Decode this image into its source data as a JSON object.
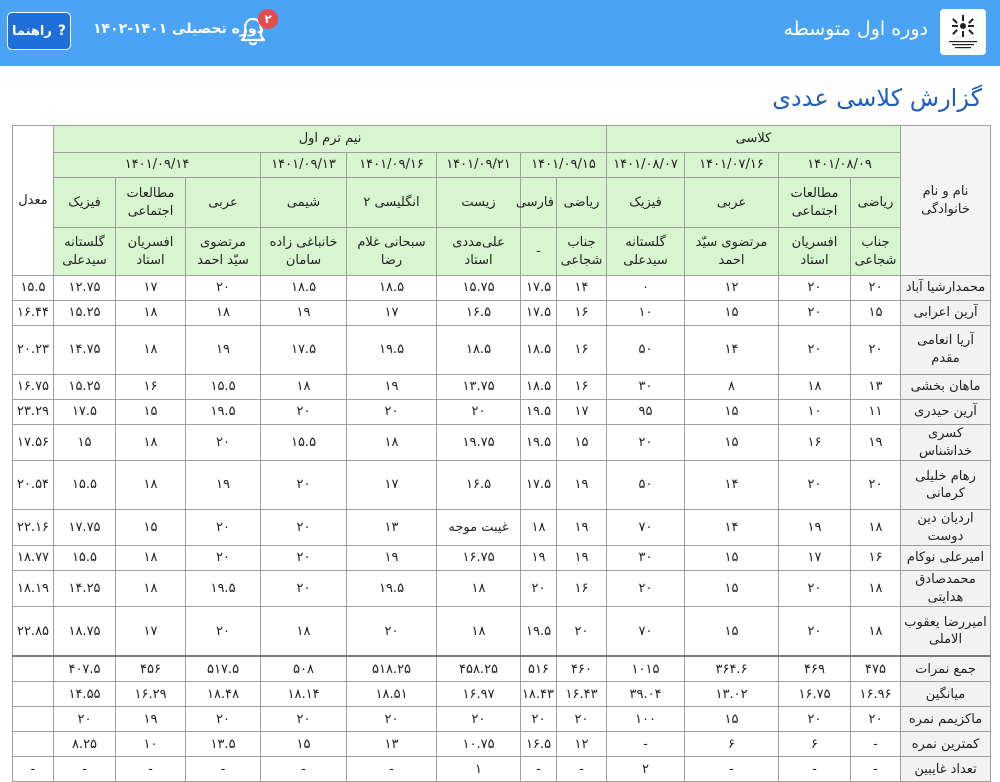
{
  "header": {
    "org_title": "دوره اول متوسطه",
    "term_label": "دوره تحصیلی ۱۴۰۱-۱۴۰۲",
    "notification_count": "۲",
    "help_label": "راهنما",
    "help_icon": "?",
    "colors": {
      "bar": "#4aa3f5",
      "button": "#1e6fd9",
      "badge": "#e54b4b"
    }
  },
  "page_title": "گزارش کلاسی عددی",
  "table": {
    "name_header": "نام و نام خانوادگی",
    "avg_header": "معدل",
    "group_class": "کلاسی",
    "group_midterm": "نیم ترم اول",
    "dates": [
      "۱۴۰۱/۰۸/۰۹",
      "۱۴۰۱/۰۷/۱۶",
      "۱۴۰۱/۰۸/۰۷",
      "۱۴۰۱/۰۹/۱۵",
      "۱۴۰۱/۰۹/۲۱",
      "۱۴۰۱/۰۹/۱۶",
      "۱۴۰۱/۰۹/۱۳",
      "۱۴۰۱/۰۹/۱۴"
    ],
    "subjects": [
      "ریاضی",
      "مطالعات اجتماعی",
      "عربی",
      "فیزیک",
      "ریاضی",
      "فارسی",
      "زیست",
      "انگلیسی ۲",
      "شیمی",
      "عربی",
      "مطالعات اجتماعی",
      "فیزیک"
    ],
    "teachers": [
      "جناب شجاعی",
      "افسریان استاد",
      "مرتضوی سیّد احمد",
      "گلستانه سیدعلی",
      "جناب شجاعی",
      "-",
      "علی‌مددی استاد",
      "سبحانی غلام رضا",
      "خانباغی زاده سامان",
      "مرتضوی سیّد احمد",
      "افسریان استاد",
      "گلستانه سیدعلی"
    ],
    "rows": [
      {
        "name": "محمدارشیا آباد",
        "scores": [
          "۲۰",
          "۲۰",
          "۱۲",
          "۰",
          "۱۴",
          "۱۷.۵",
          "۱۵.۷۵",
          "۱۸.۵",
          "۱۸.۵",
          "۲۰",
          "۱۷",
          "۱۲.۷۵"
        ],
        "avg": "۱۵.۵"
      },
      {
        "name": "آرین اعرابی",
        "scores": [
          "۱۵",
          "۲۰",
          "۱۵",
          "۱۰",
          "۱۶",
          "۱۷.۵",
          "۱۶.۵",
          "۱۷",
          "۱۹",
          "۱۸",
          "۱۸",
          "۱۵.۲۵"
        ],
        "avg": "۱۶.۴۴"
      },
      {
        "name": "آریا انعامی مقدم",
        "scores": [
          "۲۰",
          "۲۰",
          "۱۴",
          "۵۰",
          "۱۶",
          "۱۸.۵",
          "۱۸.۵",
          "۱۹.۵",
          "۱۷.۵",
          "۱۹",
          "۱۸",
          "۱۴.۷۵"
        ],
        "avg": "۲۰.۲۳"
      },
      {
        "name": "ماهان بخشی",
        "scores": [
          "۱۳",
          "۱۸",
          "۸",
          "۳۰",
          "۱۶",
          "۱۸.۵",
          "۱۳.۷۵",
          "۱۹",
          "۱۸",
          "۱۵.۵",
          "۱۶",
          "۱۵.۲۵"
        ],
        "avg": "۱۶.۷۵"
      },
      {
        "name": "آرین حیدری",
        "scores": [
          "۱۱",
          "۱۰",
          "۱۵",
          "۹۵",
          "۱۷",
          "۱۹.۵",
          "۲۰",
          "۲۰",
          "۲۰",
          "۱۹.۵",
          "۱۵",
          "۱۷.۵"
        ],
        "avg": "۲۳.۲۹"
      },
      {
        "name": "کسری خداشناس",
        "scores": [
          "۱۹",
          "۱۶",
          "۱۵",
          "۲۰",
          "۱۵",
          "۱۹.۵",
          "۱۹.۷۵",
          "۱۸",
          "۱۵.۵",
          "۲۰",
          "۱۸",
          "۱۵"
        ],
        "avg": "۱۷.۵۶"
      },
      {
        "name": "رهام خلیلی کرمانی",
        "scores": [
          "۲۰",
          "۲۰",
          "۱۴",
          "۵۰",
          "۱۹",
          "۱۷.۵",
          "۱۶.۵",
          "۱۷",
          "۲۰",
          "۱۹",
          "۱۸",
          "۱۵.۵"
        ],
        "avg": "۲۰.۵۴"
      },
      {
        "name": "اردیان دین دوست",
        "scores": [
          "۱۸",
          "۱۹",
          "۱۴",
          "۷۰",
          "۱۹",
          "۱۸",
          "غیبت موجه",
          "۱۳",
          "۲۰",
          "۲۰",
          "۱۵",
          "۱۷.۷۵"
        ],
        "avg": "۲۲.۱۶"
      },
      {
        "name": "امیرعلی نوکام",
        "scores": [
          "۱۶",
          "۱۷",
          "۱۵",
          "۳۰",
          "۱۹",
          "۱۹",
          "۱۶.۷۵",
          "۱۹",
          "۲۰",
          "۲۰",
          "۱۸",
          "۱۵.۵"
        ],
        "avg": "۱۸.۷۷"
      },
      {
        "name": "محمدصادق هدایتی",
        "scores": [
          "۱۸",
          "۲۰",
          "۱۵",
          "۲۰",
          "۱۶",
          "۲۰",
          "۱۸",
          "۱۹.۵",
          "۲۰",
          "۱۹.۵",
          "۱۸",
          "۱۴.۲۵"
        ],
        "avg": "۱۸.۱۹"
      },
      {
        "name": "امیررضا یعقوب الاملی",
        "scores": [
          "۱۸",
          "۲۰",
          "۱۵",
          "۷۰",
          "۲۰",
          "۱۹.۵",
          "۱۸",
          "۲۰",
          "۱۸",
          "۲۰",
          "۱۷",
          "۱۸.۷۵"
        ],
        "avg": "۲۲.۸۵"
      }
    ],
    "stats": [
      {
        "label": "جمع نمرات",
        "values": [
          "۴۷۵",
          "۴۶۹",
          "۳۶۴.۶",
          "۱۰۱۵",
          "۴۶۰",
          "۵۱۶",
          "۴۵۸.۲۵",
          "۵۱۸.۲۵",
          "۵۰۸",
          "۵۱۷.۵",
          "۴۵۶",
          "۴۰۷.۵"
        ],
        "avg": ""
      },
      {
        "label": "میانگین",
        "values": [
          "۱۶.۹۶",
          "۱۶.۷۵",
          "۱۳.۰۲",
          "۳۹.۰۴",
          "۱۶.۴۳",
          "۱۸.۴۳",
          "۱۶.۹۷",
          "۱۸.۵۱",
          "۱۸.۱۴",
          "۱۸.۴۸",
          "۱۶.۲۹",
          "۱۴.۵۵"
        ],
        "avg": ""
      },
      {
        "label": "ماکزیمم نمره",
        "values": [
          "۲۰",
          "۲۰",
          "۱۵",
          "۱۰۰",
          "۲۰",
          "۲۰",
          "۲۰",
          "۲۰",
          "۲۰",
          "۲۰",
          "۱۹",
          "۲۰"
        ],
        "avg": ""
      },
      {
        "label": "کمترین نمره",
        "values": [
          "-",
          "۶",
          "۶",
          "-",
          "۱۲",
          "۱۶.۵",
          "۱۰.۷۵",
          "۱۳",
          "۱۵",
          "۱۳.۵",
          "۱۰",
          "۸.۲۵"
        ],
        "avg": ""
      },
      {
        "label": "تعداد غایبین",
        "values": [
          "-",
          "-",
          "-",
          "۲",
          "-",
          "-",
          "۱",
          "-",
          "-",
          "-",
          "-",
          "-"
        ],
        "avg": "-"
      }
    ]
  }
}
